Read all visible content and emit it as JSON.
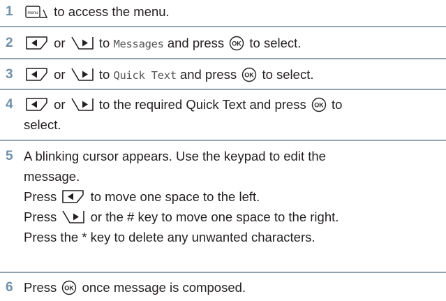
{
  "steps": [
    {
      "number": "1",
      "parts": {
        "t1": "to access the menu."
      },
      "icons": [
        "menu-key-icon"
      ]
    },
    {
      "number": "2",
      "parts": {
        "or": "or",
        "to": "to",
        "target": "Messages",
        "press": "and press",
        "end": "to select."
      },
      "icons": [
        "left-arrow-key-icon",
        "right-arrow-key-icon",
        "ok-key-icon"
      ]
    },
    {
      "number": "3",
      "parts": {
        "or": "or",
        "to": "to",
        "target": "Quick Text",
        "press": "and press",
        "end": "to select."
      },
      "icons": [
        "left-arrow-key-icon",
        "right-arrow-key-icon",
        "ok-key-icon"
      ]
    },
    {
      "number": "4",
      "parts": {
        "or": "or",
        "middle": "to the required Quick Text and press",
        "end": "to",
        "wrap": "select."
      },
      "icons": [
        "left-arrow-key-icon",
        "right-arrow-key-icon",
        "ok-key-icon"
      ]
    },
    {
      "number": "5",
      "lines": {
        "l1": "A blinking cursor appears. Use the keypad to edit the",
        "l2": "message.",
        "l3a": "Press",
        "l3b": "to move one space to the left.",
        "l4a": "Press",
        "l4b": "or the # key to move one space to the right.",
        "l5": "Press the * key to delete any unwanted characters."
      },
      "icons": [
        "left-arrow-key-icon",
        "right-arrow-key-icon"
      ]
    },
    {
      "number": "6",
      "parts": {
        "a": "Press",
        "b": "once message is composed."
      },
      "icons": [
        "ok-key-icon"
      ]
    }
  ],
  "colors": {
    "step_number": "#6f8fa8",
    "divider": "#8fa3b3",
    "text": "#231f20",
    "menu_label": "menu"
  }
}
